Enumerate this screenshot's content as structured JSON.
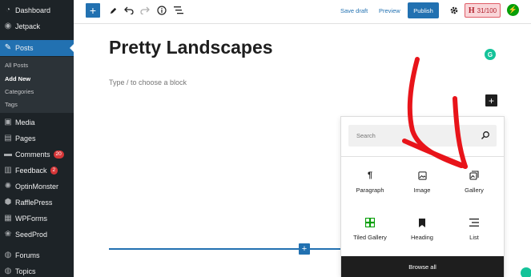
{
  "sidebar": {
    "items": [
      {
        "label": "Dashboard",
        "icon": "dashboard-icon"
      },
      {
        "label": "Jetpack",
        "icon": "jetpack-icon"
      },
      {
        "label": "Posts",
        "icon": "pin-icon"
      },
      {
        "label": "Media",
        "icon": "media-icon"
      },
      {
        "label": "Pages",
        "icon": "pages-icon"
      },
      {
        "label": "Comments",
        "icon": "comments-icon",
        "badge": "20"
      },
      {
        "label": "Feedback",
        "icon": "feedback-icon",
        "badge": "2"
      },
      {
        "label": "OptinMonster",
        "icon": "optinmonster-icon"
      },
      {
        "label": "RafflePress",
        "icon": "rafflepress-icon"
      },
      {
        "label": "WPForms",
        "icon": "wpforms-icon"
      },
      {
        "label": "SeedProd",
        "icon": "seedprod-icon"
      },
      {
        "label": "Forums",
        "icon": "forums-icon"
      },
      {
        "label": "Topics",
        "icon": "topics-icon"
      }
    ],
    "posts_submenu": [
      "All Posts",
      "Add New",
      "Categories",
      "Tags"
    ],
    "current_submenu": "Add New"
  },
  "toolbar": {
    "save_draft": "Save draft",
    "preview": "Preview",
    "publish": "Publish",
    "seo_score": "31/100",
    "seo_letter": "H"
  },
  "editor": {
    "title": "Pretty Landscapes",
    "placeholder": "Type / to choose a block"
  },
  "inserter": {
    "search_placeholder": "Search",
    "blocks": [
      {
        "label": "Paragraph",
        "icon": "paragraph-icon"
      },
      {
        "label": "Image",
        "icon": "image-icon"
      },
      {
        "label": "Gallery",
        "icon": "gallery-icon"
      },
      {
        "label": "Tiled Gallery",
        "icon": "tiled-gallery-icon"
      },
      {
        "label": "Heading",
        "icon": "heading-icon"
      },
      {
        "label": "List",
        "icon": "list-icon"
      }
    ],
    "browse_all": "Browse all"
  },
  "colors": {
    "sidebar_bg": "#1d2327",
    "accent": "#2271b1",
    "annotation_arrow": "#e8141a",
    "jetpack_green": "#069e08",
    "tiled_gallery_icon": "#069e08"
  }
}
